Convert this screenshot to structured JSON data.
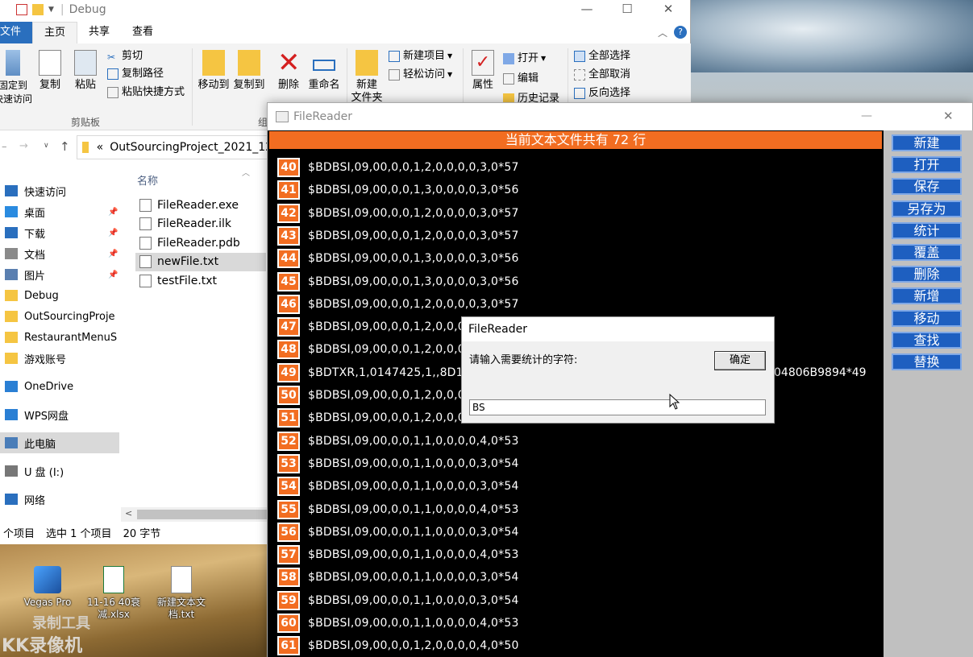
{
  "explorer": {
    "title": "Debug",
    "window_controls": [
      "—",
      "☐",
      "✕"
    ],
    "tabs": [
      "文件",
      "主页",
      "共享",
      "查看"
    ],
    "ribbon": {
      "pin": "固定到\n快速访问",
      "copy": "复制",
      "paste": "粘贴",
      "cut": "剪切",
      "copy_path": "复制路径",
      "paste_shortcut": "粘贴快捷方式",
      "clipboard_group": "剪贴板",
      "move_to": "移动到",
      "copy_to": "复制到",
      "delete": "删除",
      "rename": "重命名",
      "organize_group": "组",
      "new_folder": "新建\n文件夹",
      "new_item": "新建项目",
      "easy_access": "轻松访问",
      "properties": "属性",
      "open": "打开",
      "edit": "编辑",
      "history": "历史记录",
      "select_all": "全部选择",
      "select_none": "全部取消",
      "invert_select": "反向选择"
    },
    "address": "OutSourcingProject_2021_12_2",
    "nav": [
      {
        "label": "快速访问",
        "icon": "star-icon",
        "pin": false
      },
      {
        "label": "桌面",
        "icon": "desktop-icon",
        "pin": true
      },
      {
        "label": "下载",
        "icon": "download-icon",
        "pin": true
      },
      {
        "label": "文档",
        "icon": "document-icon",
        "pin": true
      },
      {
        "label": "图片",
        "icon": "picture-icon",
        "pin": true
      },
      {
        "label": "Debug",
        "icon": "folder-icon",
        "pin": false
      },
      {
        "label": "OutSourcingProje",
        "icon": "folder-icon",
        "pin": false
      },
      {
        "label": "RestaurantMenuS",
        "icon": "folder-icon",
        "pin": false
      },
      {
        "label": "游戏账号",
        "icon": "folder-icon",
        "pin": false
      },
      {
        "label": "OneDrive",
        "icon": "cloud-icon",
        "pin": false
      },
      {
        "label": "WPS网盘",
        "icon": "cloud-icon",
        "pin": false
      },
      {
        "label": "此电脑",
        "icon": "computer-icon",
        "pin": false
      },
      {
        "label": "U 盘 (I:)",
        "icon": "usb-drive-icon",
        "pin": false
      },
      {
        "label": "网络",
        "icon": "network-icon",
        "pin": false
      }
    ],
    "column_name": "名称",
    "files": [
      "FileReader.exe",
      "FileReader.ilk",
      "FileReader.pdb",
      "newFile.txt",
      "testFile.txt"
    ],
    "status": [
      "个项目",
      "选中 1 个项目",
      "20 字节"
    ]
  },
  "desktop": {
    "icons": [
      "Vegas Pro",
      "11-16 40衰减.xlsx",
      "新建文本文档.txt"
    ],
    "watermark": "KK录像机",
    "watermark2": "录制工具"
  },
  "filereader": {
    "title": "FileReader",
    "header": "当前文本文件共有 72 行",
    "buttons": [
      "新建",
      "打开",
      "保存",
      "另存为",
      "统计",
      "覆盖",
      "删除",
      "新增",
      "移动",
      "查找",
      "替换"
    ],
    "lines": [
      {
        "num": "40",
        "text": "$BDBSI,09,00,0,0,1,2,0,0,0,0,3,0*57"
      },
      {
        "num": "41",
        "text": "$BDBSI,09,00,0,0,1,3,0,0,0,0,3,0*56"
      },
      {
        "num": "42",
        "text": "$BDBSI,09,00,0,0,1,2,0,0,0,0,3,0*57"
      },
      {
        "num": "43",
        "text": "$BDBSI,09,00,0,0,1,2,0,0,0,0,3,0*57"
      },
      {
        "num": "44",
        "text": "$BDBSI,09,00,0,0,1,3,0,0,0,0,3,0*56"
      },
      {
        "num": "45",
        "text": "$BDBSI,09,00,0,0,1,3,0,0,0,0,3,0*56"
      },
      {
        "num": "46",
        "text": "$BDBSI,09,00,0,0,1,2,0,0,0,0,3,0*57"
      },
      {
        "num": "47",
        "text": "$BDBSI,09,00,0,0,1,2,0,0,0"
      },
      {
        "num": "48",
        "text": "$BDBSI,09,00,0,0,1,2,0,0,0"
      },
      {
        "num": "49",
        "text": "$BDTXR,1,0147425,1,,8D1"
      },
      {
        "num": "50",
        "text": "$BDBSI,09,00,0,0,1,2,0,0,0"
      },
      {
        "num": "51",
        "text": "$BDBSI,09,00,0,0,1,2,0,0,0"
      },
      {
        "num": "52",
        "text": "$BDBSI,09,00,0,0,1,1,0,0,0,0,4,0*53"
      },
      {
        "num": "53",
        "text": "$BDBSI,09,00,0,0,1,1,0,0,0,0,3,0*54"
      },
      {
        "num": "54",
        "text": "$BDBSI,09,00,0,0,1,1,0,0,0,0,3,0*54"
      },
      {
        "num": "55",
        "text": "$BDBSI,09,00,0,0,1,1,0,0,0,0,4,0*53"
      },
      {
        "num": "56",
        "text": "$BDBSI,09,00,0,0,1,1,0,0,0,0,3,0*54"
      },
      {
        "num": "57",
        "text": "$BDBSI,09,00,0,0,1,1,0,0,0,0,4,0*53"
      },
      {
        "num": "58",
        "text": "$BDBSI,09,00,0,0,1,1,0,0,0,0,3,0*54"
      },
      {
        "num": "59",
        "text": "$BDBSI,09,00,0,0,1,1,0,0,0,0,3,0*54"
      },
      {
        "num": "60",
        "text": "$BDBSI,09,00,0,0,1,1,0,0,0,0,4,0*53"
      },
      {
        "num": "61",
        "text": "$BDBSI,09,00,0,0,1,2,0,0,0,0,4,0*50"
      }
    ],
    "line49_tail": "04806B9894*49"
  },
  "dialog": {
    "title": "FileReader",
    "prompt": "请输入需要统计的字符:",
    "ok": "确定",
    "input_value": "BS"
  },
  "colors": {
    "accent_orange": "#f26d21",
    "button_blue": "#1e5fc0",
    "file_tab_blue": "#2a6fbe"
  }
}
